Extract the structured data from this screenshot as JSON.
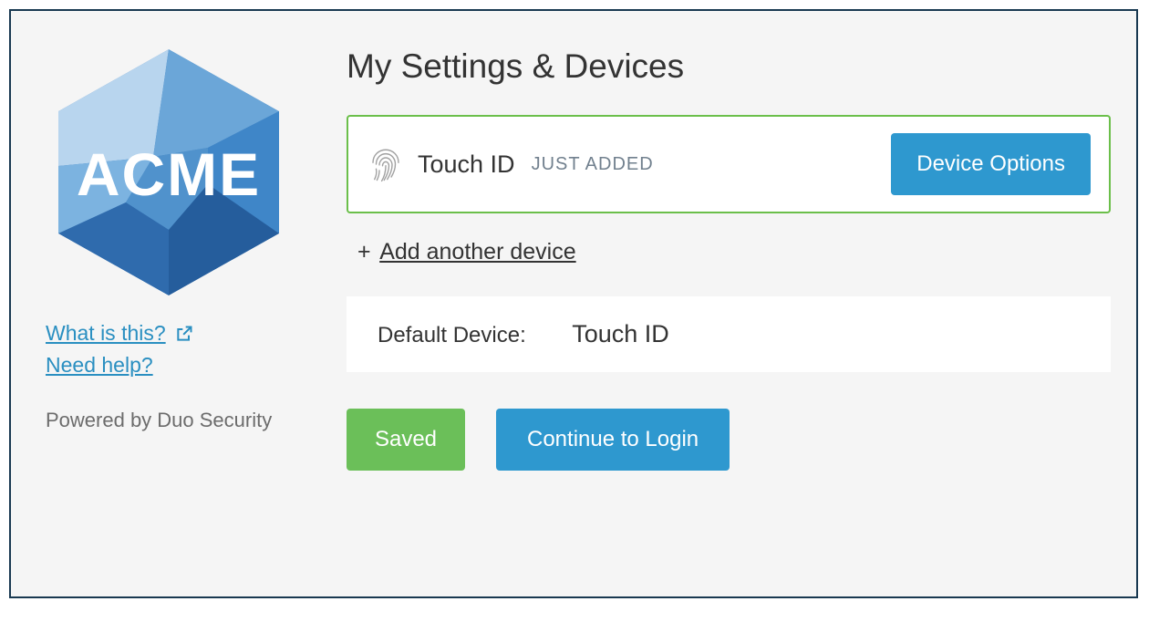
{
  "sidebar": {
    "brand_text": "ACME",
    "what_is_this": "What is this?",
    "need_help": "Need help?",
    "powered_by": "Powered by Duo Security"
  },
  "main": {
    "title": "My Settings & Devices",
    "device": {
      "name": "Touch ID",
      "status": "JUST ADDED",
      "options_button": "Device Options"
    },
    "add_device": {
      "plus": "+",
      "label": "Add another device"
    },
    "default_device": {
      "label": "Default Device:",
      "value": "Touch ID"
    },
    "actions": {
      "saved": "Saved",
      "continue": "Continue to Login"
    }
  }
}
